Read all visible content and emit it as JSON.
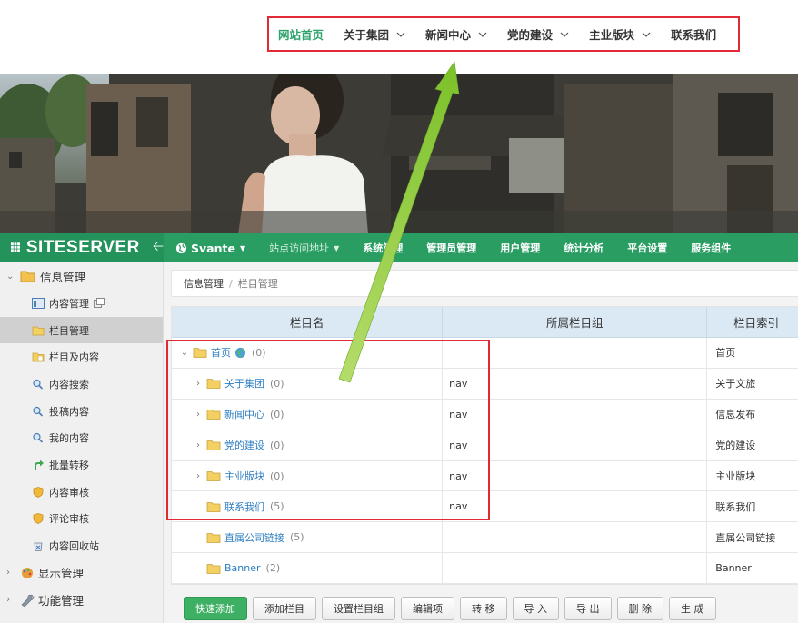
{
  "site_nav": {
    "items": [
      {
        "label": "网站首页",
        "active": true,
        "dropdown": false
      },
      {
        "label": "关于集团",
        "active": false,
        "dropdown": true
      },
      {
        "label": "新闻中心",
        "active": false,
        "dropdown": true
      },
      {
        "label": "党的建设",
        "active": false,
        "dropdown": true
      },
      {
        "label": "主业版块",
        "active": false,
        "dropdown": true
      },
      {
        "label": "联系我们",
        "active": false,
        "dropdown": false
      }
    ]
  },
  "header": {
    "logo": "SITESERVER",
    "site_name": "Svante",
    "menu": [
      "站点访问地址",
      "系统管理",
      "管理员管理",
      "用户管理",
      "统计分析",
      "平台设置",
      "服务组件"
    ]
  },
  "sidebar": {
    "groups": [
      {
        "label": "信息管理",
        "expanded": true
      },
      {
        "label": "显示管理",
        "expanded": false
      },
      {
        "label": "功能管理",
        "expanded": false
      }
    ],
    "items": [
      {
        "label": "内容管理",
        "icon": "content-list-icon"
      },
      {
        "label": "栏目管理",
        "icon": "folder-icon",
        "active": true
      },
      {
        "label": "栏目及内容",
        "icon": "folder-content-icon"
      },
      {
        "label": "内容搜索",
        "icon": "magnifier-icon"
      },
      {
        "label": "投稿内容",
        "icon": "magnifier-icon"
      },
      {
        "label": "我的内容",
        "icon": "magnifier-icon"
      },
      {
        "label": "批量转移",
        "icon": "transfer-arrow-icon"
      },
      {
        "label": "内容审核",
        "icon": "shield-icon"
      },
      {
        "label": "评论审核",
        "icon": "shield-icon"
      },
      {
        "label": "内容回收站",
        "icon": "recycle-bin-icon"
      }
    ]
  },
  "breadcrumb": {
    "root": "信息管理",
    "current": "栏目管理"
  },
  "table": {
    "headers": [
      "栏目名",
      "所属栏目组",
      "栏目索引"
    ],
    "rows": [
      {
        "name": "首页",
        "count": "(0)",
        "group": "",
        "index": "首页"
      },
      {
        "name": "关于集团",
        "count": "(0)",
        "group": "nav",
        "index": "关于文旅"
      },
      {
        "name": "新闻中心",
        "count": "(0)",
        "group": "nav",
        "index": "信息发布"
      },
      {
        "name": "党的建设",
        "count": "(0)",
        "group": "nav",
        "index": "党的建设"
      },
      {
        "name": "主业版块",
        "count": "(0)",
        "group": "nav",
        "index": "主业版块"
      },
      {
        "name": "联系我们",
        "count": "(5)",
        "group": "nav",
        "index": "联系我们"
      },
      {
        "name": "直属公司链接",
        "count": "(5)",
        "group": "",
        "index": "直属公司链接"
      },
      {
        "name": "Banner",
        "count": "(2)",
        "group": "",
        "index": "Banner"
      }
    ]
  },
  "buttons": [
    "快速添加",
    "添加栏目",
    "设置栏目组",
    "编辑项",
    "转 移",
    "导 入",
    "导 出",
    "删 除",
    "生 成"
  ],
  "colors": {
    "brand_green": "#2a9d63",
    "highlight_red": "#e02b36",
    "arrow_green": "#8cc63f",
    "link_blue": "#2d7ec2"
  }
}
